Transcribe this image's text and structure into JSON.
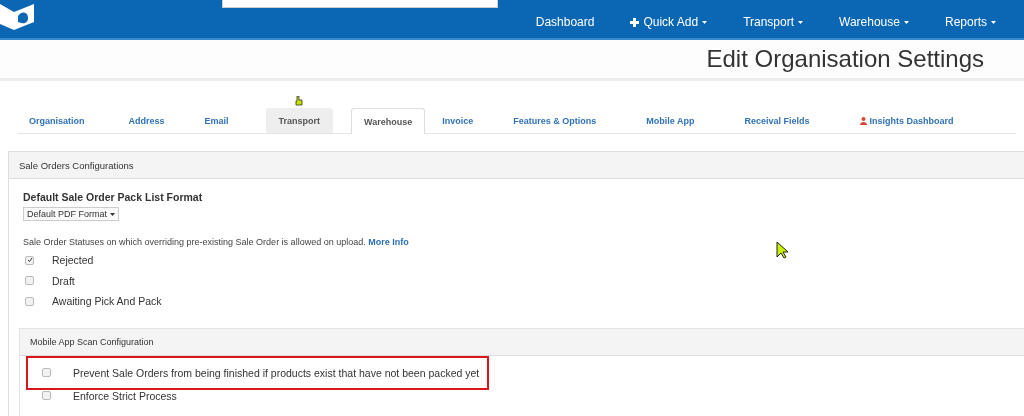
{
  "nav": [
    {
      "label": "Dashboard",
      "kind": "link"
    },
    {
      "label": "Quick Add",
      "kind": "add-menu"
    },
    {
      "label": "Transport",
      "kind": "menu"
    },
    {
      "label": "Warehouse",
      "kind": "menu"
    },
    {
      "label": "Reports",
      "kind": "menu"
    }
  ],
  "page_title": "Edit Organisation Settings",
  "tabs": [
    {
      "label": "Organisation",
      "selected": false,
      "hovered": false
    },
    {
      "label": "Address",
      "selected": false,
      "hovered": false
    },
    {
      "label": "Email",
      "selected": false,
      "hovered": false
    },
    {
      "label": "Transport",
      "selected": false,
      "hovered": true
    },
    {
      "label": "Warehouse",
      "selected": true,
      "hovered": false
    },
    {
      "label": "Invoice",
      "selected": false,
      "hovered": false
    },
    {
      "label": "Features & Options",
      "selected": false,
      "hovered": false
    },
    {
      "label": "Mobile App",
      "selected": false,
      "hovered": false
    },
    {
      "label": "Receival Fields",
      "selected": false,
      "hovered": false
    },
    {
      "label": "Insights Dashboard",
      "selected": false,
      "hovered": false,
      "kind": "user"
    }
  ],
  "panel": {
    "title": "Sale Orders Configurations",
    "pack_list": {
      "label": "Default Sale Order Pack List Format",
      "value": "Default PDF Format"
    },
    "statuses_note": "Sale Order Statuses on which overriding pre-existing Sale Order is allowed on upload.",
    "more_info": "More Info",
    "statuses": [
      {
        "label": "Rejected",
        "checked": true
      },
      {
        "label": "Draft",
        "checked": false
      },
      {
        "label": "Awaiting Pick And Pack",
        "checked": false
      }
    ],
    "mobile": {
      "title": "Mobile App Scan Configuration",
      "options": [
        {
          "label": "Prevent Sale Orders from being finished if products exist that have not been packed yet",
          "checked": false,
          "highlighted": true
        },
        {
          "label": "Enforce Strict Process",
          "checked": false,
          "highlighted": false
        }
      ]
    }
  }
}
